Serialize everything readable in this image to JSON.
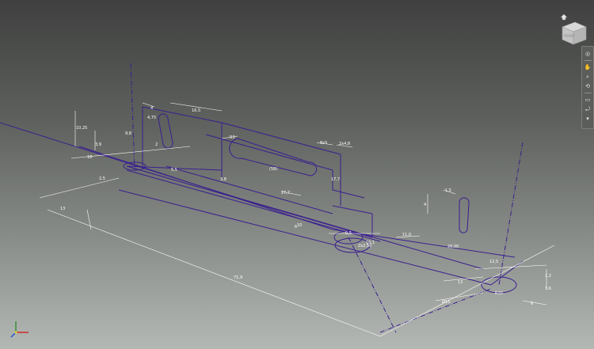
{
  "viewcube": {
    "face_label": "FRONT",
    "home_icon": "home-icon"
  },
  "navbar": {
    "tools": [
      {
        "name": "steering-wheel-icon",
        "glyph": "◎"
      },
      {
        "name": "pan-icon",
        "glyph": "✋"
      },
      {
        "name": "zoom-icon",
        "glyph": "⌕"
      },
      {
        "name": "orbit-icon",
        "glyph": "⟲"
      },
      {
        "name": "look-at-icon",
        "glyph": "▭"
      },
      {
        "name": "free-orbit-icon",
        "glyph": "⤾"
      },
      {
        "name": "more-icon",
        "glyph": "▾"
      }
    ]
  },
  "dimensions": {
    "d1": "10,25",
    "d2": "9,8",
    "d3": "18",
    "d4": "4",
    "d5": "4,75",
    "d6": "16,5",
    "d7": "2",
    "d8": "2,5",
    "d9": "3,9",
    "d10": "5,5",
    "d11": "R3",
    "d12": "3,8",
    "d13": "27,7",
    "d14": "(58)",
    "d15": "8x5",
    "d16": "2x4,8",
    "d17": "17,7",
    "d18": "10",
    "d19": "71,9",
    "d20": "13",
    "d21": "1,5",
    "d22": "4",
    "d23": "6",
    "d24": "0,5",
    "d25": "2x2,50",
    "d26": "10,1",
    "d27": "20,00",
    "d28": "11,0",
    "d29": "13",
    "d30": "Ø15",
    "d31": "R20",
    "d32": "1,2",
    "d33": "3,6",
    "d34": "6",
    "d35": "12,5"
  },
  "colors": {
    "profile": "#3a1f8f",
    "dimension": "#ffffff",
    "axis": "#4a2fa0"
  }
}
